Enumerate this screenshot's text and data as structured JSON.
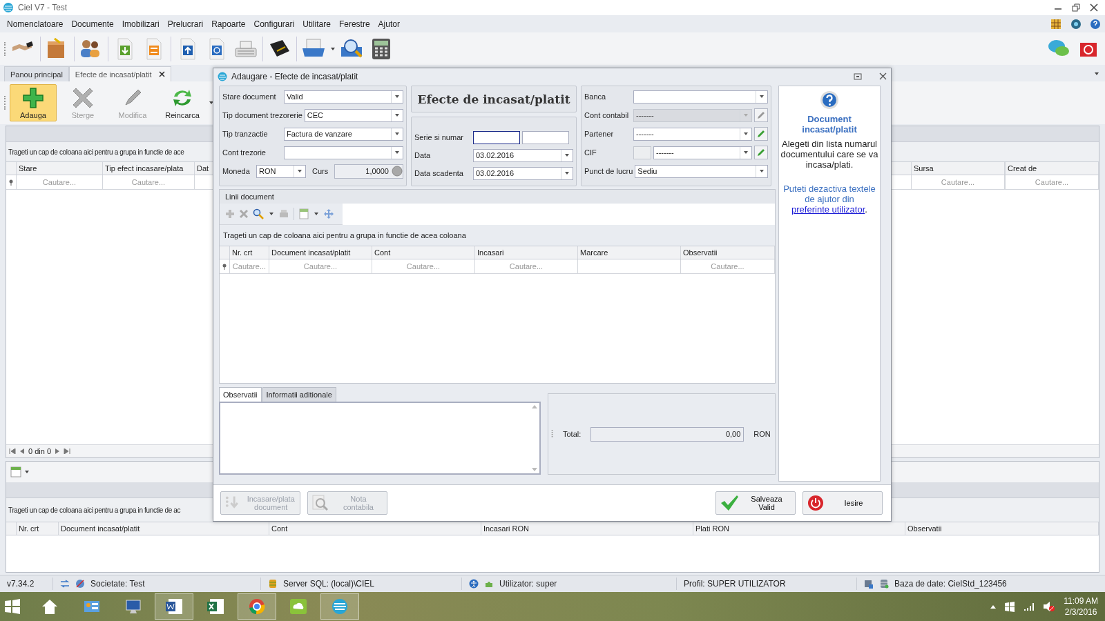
{
  "window": {
    "title": "Ciel V7 - Test"
  },
  "menu": [
    "Nomenclatoare",
    "Documente",
    "Imobilizari",
    "Prelucrari",
    "Rapoarte",
    "Configurari",
    "Utilitare",
    "Ferestre",
    "Ajutor"
  ],
  "tabs": [
    {
      "label": "Panou principal",
      "selected": false
    },
    {
      "label": "Efecte de incasat/platit",
      "selected": true
    }
  ],
  "ribbon": [
    {
      "label": "Adauga",
      "kind": "add",
      "selected": true,
      "disabled": false
    },
    {
      "label": "Sterge",
      "kind": "delete",
      "selected": false,
      "disabled": true
    },
    {
      "label": "Modifica",
      "kind": "edit",
      "selected": false,
      "disabled": true
    },
    {
      "label": "Reincarca",
      "kind": "reload",
      "selected": false,
      "disabled": false
    }
  ],
  "main_grid": {
    "group_hint": "Trageti un cap de coloana aici pentru a grupa in functie de ace",
    "columns": [
      {
        "label": "Stare",
        "filter": "Cautare..."
      },
      {
        "label": "Tip efect incasare/plata",
        "filter": "Cautare..."
      },
      {
        "label": "Dat"
      }
    ],
    "right_columns": [
      {
        "label": "Sursa",
        "filter": "Cautare..."
      },
      {
        "label": "Creat de",
        "filter": "Cautare..."
      }
    ],
    "pager": "0 din 0"
  },
  "detail_grid": {
    "group_hint": "Trageti un cap de coloana aici pentru a grupa in functie de ac",
    "columns": [
      "Nr. crt",
      "Document incasat/platit",
      "Cont",
      "Incasari RON",
      "Plati RON",
      "Observatii"
    ]
  },
  "dialog": {
    "title": "Adaugare - Efecte de incasat/platit",
    "heading": "Efecte de incasat/platit",
    "fields_left": [
      {
        "label": "Stare document",
        "value": "Valid"
      },
      {
        "label": "Tip document trezorerie",
        "value": "CEC"
      },
      {
        "label": "Tip tranzactie",
        "value": "Factura de vanzare"
      },
      {
        "label": "Cont trezorie"
      }
    ],
    "currency": {
      "label": "Moneda",
      "value": "RON"
    },
    "rate": {
      "label": "Curs",
      "value": "1,0000"
    },
    "series": {
      "label": "Serie si numar",
      "inputs": [
        {
          "focused": true
        },
        {
          "focused": false
        }
      ]
    },
    "dates": [
      {
        "label": "Data",
        "value": "03.02.2016"
      },
      {
        "label": "Data scadenta",
        "value": "03.02.2016"
      }
    ],
    "fields_right": [
      {
        "label": "Banca",
        "kind": "combo",
        "disabled": false,
        "edit_button": false
      },
      {
        "label": "Cont contabil",
        "value": "-------",
        "kind": "combo",
        "disabled": true,
        "edit_button": true
      },
      {
        "label": "Partener",
        "value": "-------",
        "kind": "combo",
        "disabled": false,
        "edit_button": true
      },
      {
        "label": "CIF",
        "value": "-------",
        "kind": "cif",
        "disabled": false,
        "edit_button": true
      },
      {
        "label": "Punct de lucru",
        "value": "Sediu",
        "kind": "combo",
        "disabled": false,
        "edit_button": false
      }
    ],
    "help": {
      "title": "Document incasat/platit",
      "text": "Alegeti din lista numarul documentului care se va incasa/plati.",
      "note": "Puteti dezactiva textele de ajutor din ",
      "link": "preferinte utilizator",
      "note_end": "."
    },
    "lines": {
      "title": "Linii document",
      "group_hint": "Trageti un cap de coloana aici pentru a grupa in functie de acea coloana",
      "columns": [
        {
          "label": "Nr. crt",
          "filter": "Cautare..."
        },
        {
          "label": "Document incasat/platit",
          "filter": "Cautare..."
        },
        {
          "label": "Cont",
          "filter": "Cautare..."
        },
        {
          "label": "Incasari",
          "filter": "Cautare..."
        },
        {
          "label": "Marcare"
        },
        {
          "label": "Observatii",
          "filter": "Cautare..."
        }
      ]
    },
    "bottom_tabs": [
      {
        "label": "Observatii",
        "selected": true
      },
      {
        "label": "Informatii aditionale",
        "selected": false
      }
    ],
    "total": {
      "label": "Total:",
      "value": "0,00",
      "currency": "RON"
    },
    "buttons": [
      {
        "label": "Incasare/plata document",
        "kind": "collect",
        "disabled": true
      },
      {
        "label": "Nota contabila",
        "kind": "note",
        "disabled": true
      },
      {
        "label": "Salveaza Valid",
        "kind": "save",
        "disabled": false
      },
      {
        "label": "Iesire",
        "kind": "exit",
        "disabled": false
      }
    ]
  },
  "status_bar": [
    {
      "kind": "version",
      "text": "v7.34.2"
    },
    {
      "kind": "company",
      "text": "Societate: Test"
    },
    {
      "kind": "server",
      "text": "Server SQL: (local)\\CIEL"
    },
    {
      "kind": "user",
      "text": "Utilizator: super"
    },
    {
      "kind": "profile",
      "text": "Profil: SUPER UTILIZATOR"
    },
    {
      "kind": "database",
      "text": "Baza de date: CielStd_123456"
    }
  ],
  "taskbar": {
    "apps": [
      {
        "kind": "home",
        "open": false
      },
      {
        "kind": "panel",
        "open": false
      },
      {
        "kind": "computer",
        "open": false
      },
      {
        "kind": "word",
        "open": true
      },
      {
        "kind": "excel",
        "open": false
      },
      {
        "kind": "chrome",
        "open": true
      },
      {
        "kind": "cloud",
        "open": false
      },
      {
        "kind": "ciel",
        "open": true
      }
    ],
    "time": "11:09 AM",
    "date": "2/3/2016"
  }
}
